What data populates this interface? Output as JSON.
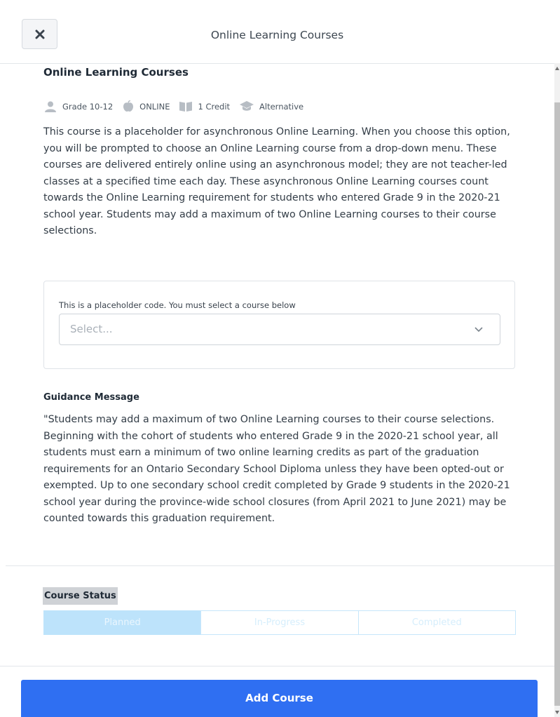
{
  "header": {
    "title": "Online Learning Courses",
    "close_icon": "close-icon"
  },
  "course": {
    "title": "Online Learning Courses",
    "meta": {
      "grade": "Grade 10-12",
      "delivery": "ONLINE",
      "credit": "1 Credit",
      "type": "Alternative"
    },
    "description": "This course is a placeholder for asynchronous Online Learning. When you choose this option, you will be prompted to choose an Online Learning course from a drop-down menu. These courses are delivered entirely online using an asynchronous model; they are not teacher-led classes at a specified time each day. These asynchronous Online Learning courses count towards the Online Learning requirement for students who entered Grade 9 in the 2020-21 school year. Students may add a maximum of two Online Learning courses to their course selections."
  },
  "select": {
    "label": "This is a placeholder code. You must select a course below",
    "placeholder": "Select..."
  },
  "guidance": {
    "title": "Guidance Message",
    "text": "\"Students may add a maximum of two Online Learning courses to their course selections. Beginning with the cohort of students who entered Grade 9 in the 2020-21 school year, all students must earn a minimum of two online learning credits as part of the graduation requirements for an Ontario Secondary School Diploma unless they have been opted-out or exempted. Up to one secondary school credit completed by Grade 9 students in the 2020-21 school year during the province-wide school closures (from April 2021 to June 2021) may be counted towards this graduation requirement."
  },
  "status": {
    "title": "Course Status",
    "options": [
      "Planned",
      "In-Progress",
      "Completed"
    ],
    "selected": "Planned"
  },
  "footer": {
    "add_label": "Add Course"
  },
  "colors": {
    "primary": "#2f6ff2",
    "segment_active": "#bde3fb"
  }
}
